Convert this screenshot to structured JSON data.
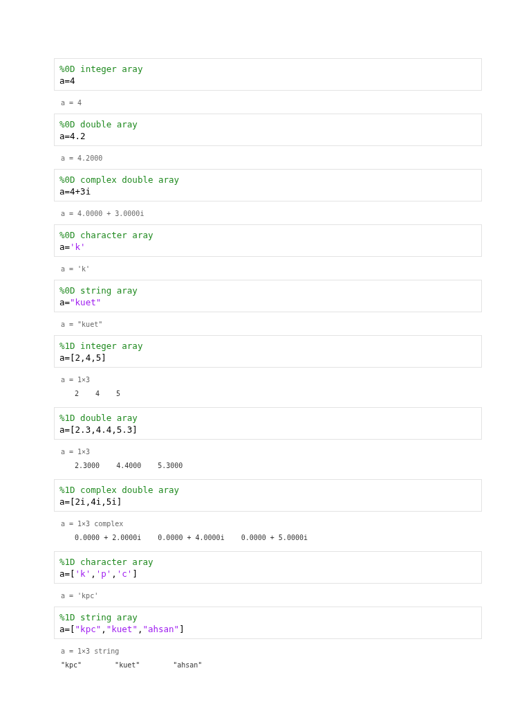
{
  "cells": [
    {
      "comment": "%0D integer aray",
      "code": "a=4",
      "output": {
        "header": "a = 4"
      }
    },
    {
      "comment": "%0D double aray",
      "code": "a=4.2",
      "output": {
        "header": "a = 4.2000"
      }
    },
    {
      "comment": "%0D complex double aray",
      "code": "a=4+3i",
      "output": {
        "header": "a = 4.0000 + 3.0000i"
      }
    },
    {
      "comment": "%0D character aray",
      "code": "a='k'",
      "output": {
        "header": "a = 'k'"
      }
    },
    {
      "comment": "%0D string aray",
      "code": "a=\"kuet\"",
      "output": {
        "header": "a = \"kuet\""
      }
    },
    {
      "comment": "%1D integer aray",
      "code": "a=[2,4,5]",
      "output": {
        "header": "a = 1×3",
        "kind": "numeric",
        "values": [
          "2",
          "4",
          "5"
        ]
      }
    },
    {
      "comment": "%1D double aray",
      "code": "a=[2.3,4.4,5.3]",
      "output": {
        "header": "a = 1×3",
        "kind": "numeric",
        "values": [
          "2.3000",
          "4.4000",
          "5.3000"
        ]
      }
    },
    {
      "comment": "%1D complex double aray",
      "code": "a=[2i,4i,5i]",
      "output": {
        "header": "a = 1×3 complex",
        "kind": "numeric",
        "values": [
          "0.0000 + 2.0000i",
          "0.0000 + 4.0000i",
          "0.0000 + 5.0000i"
        ]
      }
    },
    {
      "comment": "%1D character aray",
      "code": "a=['k','p','c']",
      "output": {
        "header": "a = 'kpc'"
      }
    },
    {
      "comment": "%1D string aray",
      "code": "a=[\"kpc\",\"kuet\",\"ahsan\"]",
      "output": {
        "header": "a = 1×3 string",
        "kind": "text",
        "values": [
          "\"kpc\"",
          "\"kuet\"",
          "\"ahsan\""
        ]
      }
    }
  ]
}
